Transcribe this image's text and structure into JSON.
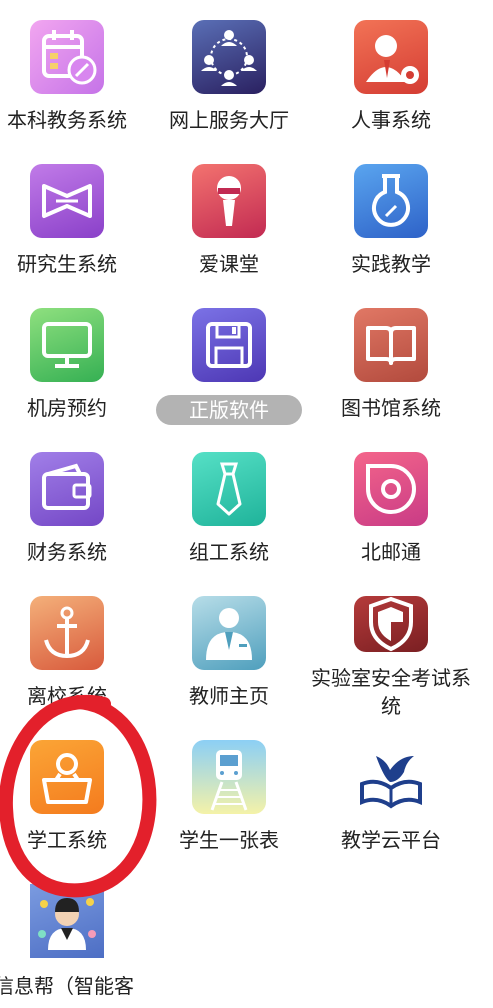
{
  "apps": [
    {
      "label": "本科教务系统",
      "icon": "calendar-pencil-icon"
    },
    {
      "label": "网上服务大厅",
      "icon": "people-network-icon"
    },
    {
      "label": "人事系统",
      "icon": "person-phone-icon"
    },
    {
      "label": "研究生系统",
      "icon": "bowtie-icon"
    },
    {
      "label": "爱课堂",
      "icon": "microphone-icon"
    },
    {
      "label": "实践教学",
      "icon": "flask-icon"
    },
    {
      "label": "机房预约",
      "icon": "monitor-icon"
    },
    {
      "label": "正版软件",
      "icon": "floppy-disk-icon"
    },
    {
      "label": "图书馆系统",
      "icon": "open-book-icon"
    },
    {
      "label": "财务系统",
      "icon": "wallet-icon"
    },
    {
      "label": "组工系统",
      "icon": "necktie-icon"
    },
    {
      "label": "北邮通",
      "icon": "round-logo-icon"
    },
    {
      "label": "离校系统",
      "icon": "anchor-icon"
    },
    {
      "label": "教师主页",
      "icon": "teacher-suit-icon"
    },
    {
      "label": "实验室安全考试系统",
      "icon": "shield-icon"
    },
    {
      "label": "学工系统",
      "icon": "student-desk-icon"
    },
    {
      "label": "学生一张表",
      "icon": "train-track-icon"
    },
    {
      "label": "教学云平台",
      "icon": "bird-book-icon"
    },
    {
      "label": "信息帮（智能客服）",
      "icon": "support-agent-icon"
    }
  ],
  "bottom_cut_text": "信息帮（智能客"
}
